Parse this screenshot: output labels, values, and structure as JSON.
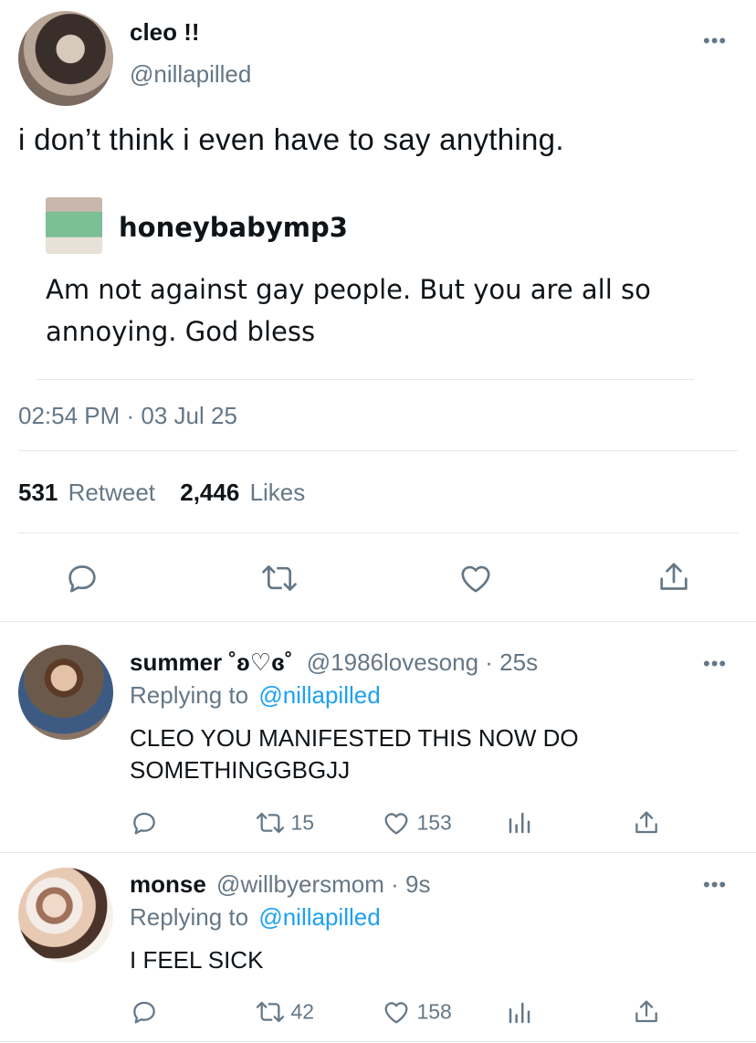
{
  "tweet": {
    "display_name": "cleo !!",
    "handle": "@nillapilled",
    "text": "i don’t think i even have to say anything.",
    "quoted": {
      "username": "honeybabymp3",
      "text_line1": "Am not against gay people. But you are all so",
      "text_line2": "annoying. God bless"
    },
    "time": "02:54 PM · 03 Jul 25",
    "retweet_count": "531",
    "retweet_label": "Retweet",
    "like_count": "2,446",
    "like_label": "Likes",
    "more": "•••"
  },
  "replies": [
    {
      "display_name": "summer ˚ʚ♡ɞ˚",
      "handle_time": "@1986lovesong · 25s",
      "replying_prefix": "Replying to",
      "replying_to": "@nillapilled",
      "text_line1": "CLEO YOU MANIFESTED THIS NOW DO",
      "text_line2": "SOMETHINGGBGJJ",
      "retweets": "15",
      "likes": "153",
      "more": "•••"
    },
    {
      "display_name": "monse",
      "handle_time": "@willbyersmom · 9s",
      "replying_prefix": "Replying to",
      "replying_to": "@nillapilled",
      "text_line1": "I FEEL SICK",
      "retweets": "42",
      "likes": "158",
      "more": "•••"
    }
  ],
  "icons": [
    "reply-icon",
    "retweet-icon",
    "like-icon",
    "share-icon",
    "analytics-icon",
    "more-icon"
  ]
}
